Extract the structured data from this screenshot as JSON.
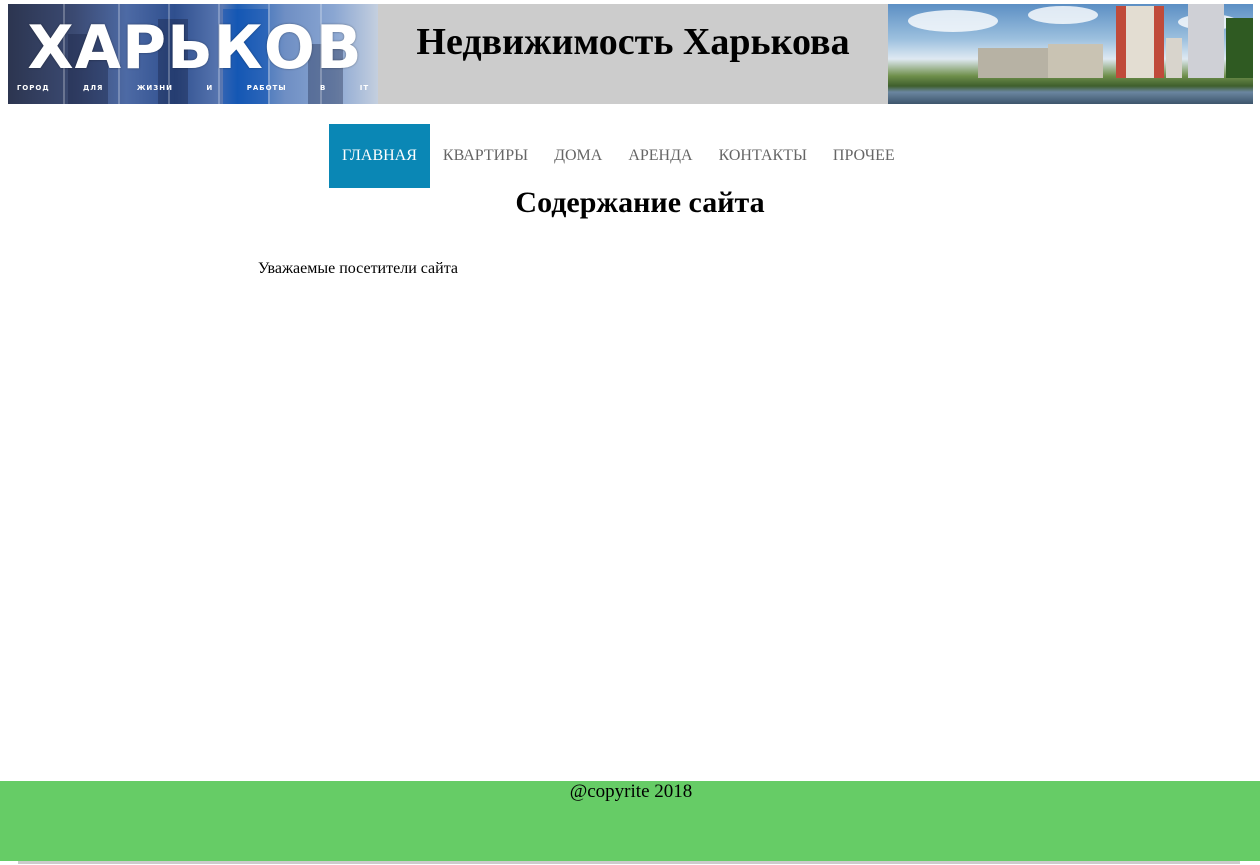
{
  "header": {
    "logo_text": "ХАРЬКОВ",
    "logo_tagline": "ГОРОД ДЛЯ ЖИЗНИ И РАБОТЫ В IT",
    "site_title": "Недвижимость Харькова"
  },
  "nav": {
    "items": [
      {
        "label": "ГЛАВНАЯ",
        "active": true
      },
      {
        "label": "КВАРТИРЫ",
        "active": false
      },
      {
        "label": "ДОМА",
        "active": false
      },
      {
        "label": "АРЕНДА",
        "active": false
      },
      {
        "label": "КОНТАКТЫ",
        "active": false
      },
      {
        "label": "ПРОЧЕЕ",
        "active": false
      }
    ],
    "active_color": "#0a87b5"
  },
  "main": {
    "title": "Содержание сайта",
    "intro": "Уважаемые посетители сайта"
  },
  "footer": {
    "text": "@copyrite 2018",
    "color": "#66cc66"
  }
}
